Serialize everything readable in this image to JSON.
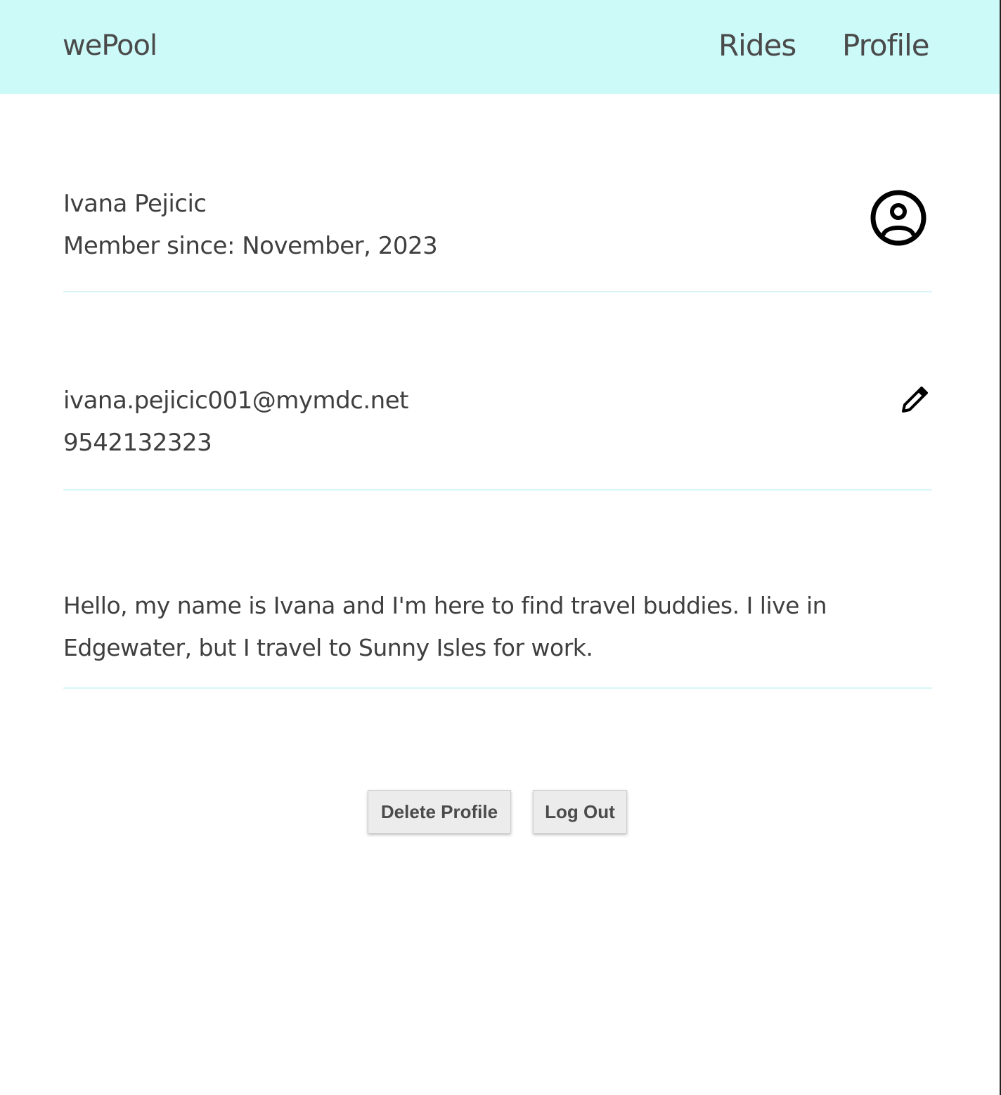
{
  "header": {
    "brand": "wePool",
    "nav": {
      "rides": "Rides",
      "profile": "Profile"
    },
    "background": "#ccfaf9"
  },
  "profile": {
    "name": "Ivana Pejicic",
    "member_since": "Member since: November, 2023",
    "avatar_icon": "user-circle-icon",
    "email": "ivana.pejicic001@mymdc.net",
    "phone": "9542132323",
    "edit_icon": "pencil-icon",
    "bio": "Hello, my name is Ivana and I'm here to find travel buddies. I live in Edgewater, but I travel to Sunny Isles for work."
  },
  "actions": {
    "delete_label": "Delete Profile",
    "logout_label": "Log Out"
  },
  "colors": {
    "divider": "#d8f6f8",
    "text": "#3f3f3f",
    "button_bg": "#ececec"
  }
}
